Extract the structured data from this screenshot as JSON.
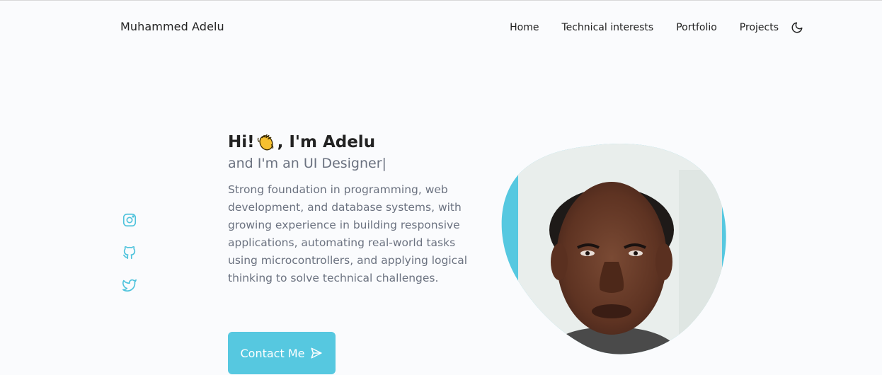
{
  "header": {
    "logo": "Muhammed Adelu",
    "nav": [
      "Home",
      "Technical interests",
      "Portfolio",
      "Projects"
    ],
    "theme_toggle_icon": "moon-icon"
  },
  "socials": [
    {
      "icon": "instagram-icon"
    },
    {
      "icon": "github-icon"
    },
    {
      "icon": "twitter-icon"
    }
  ],
  "hero": {
    "hi": "Hi!",
    "emoji": "👋",
    "name": ", I'm Adelu",
    "subtitle": "and I'm an UI Designer|",
    "description": "Strong foundation in programming, web development, and database systems, with growing experience in building responsive applications, automating real-world tasks using microcontrollers, and applying logical thinking to solve technical challenges.",
    "contact_label": "Contact Me",
    "contact_icon": "send-icon"
  },
  "colors": {
    "accent": "#56c8e0",
    "text": "#222222",
    "muted": "#6b7280",
    "background": "#fafbfd"
  }
}
